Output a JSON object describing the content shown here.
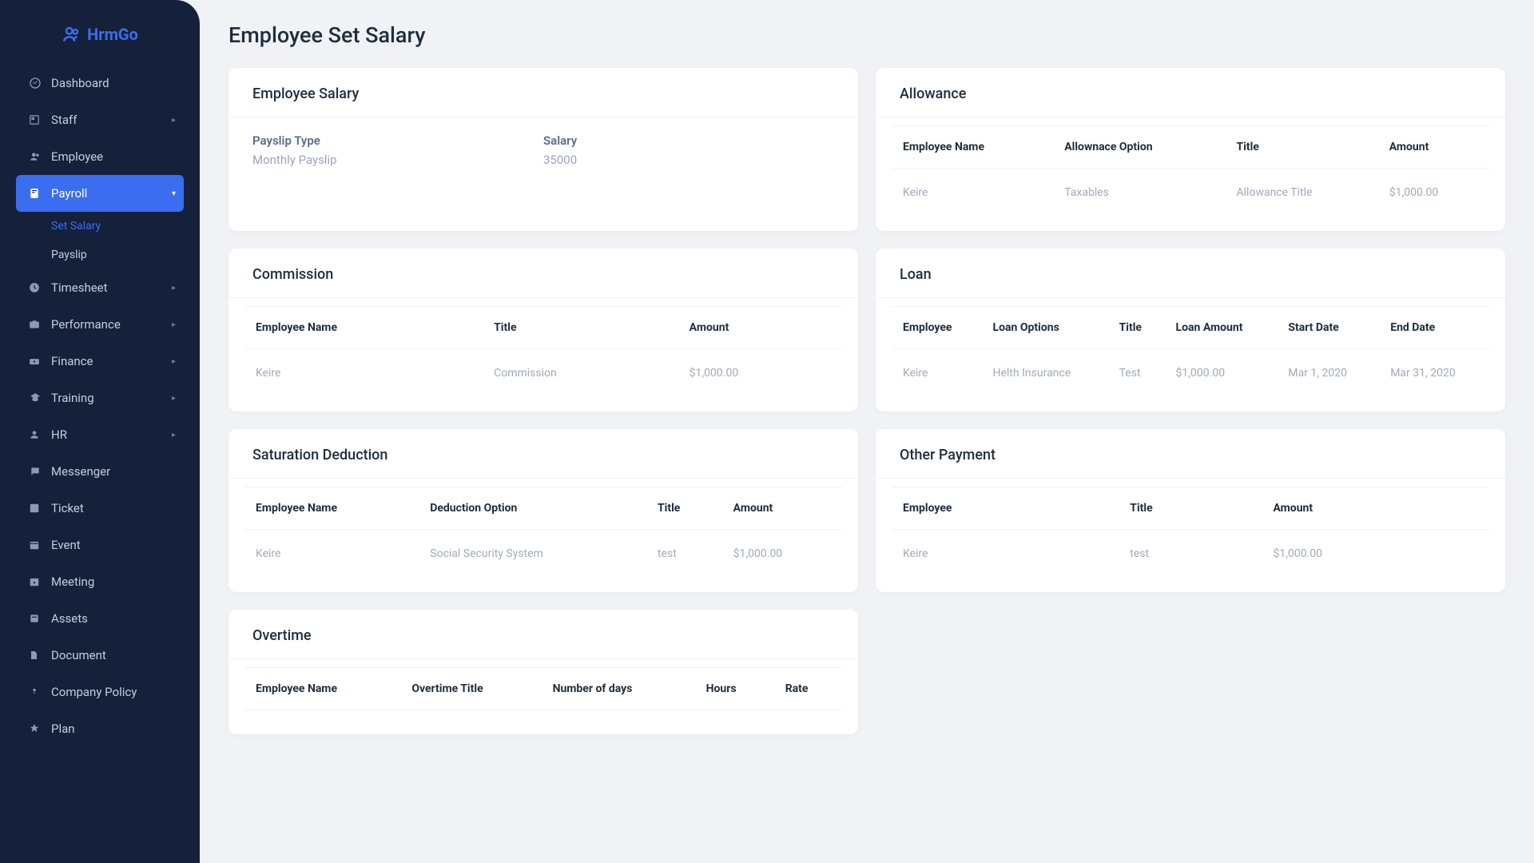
{
  "brand": "HrmGo",
  "sidebar": {
    "items": [
      {
        "icon": "dashboard",
        "label": "Dashboard",
        "expandable": false
      },
      {
        "icon": "staff",
        "label": "Staff",
        "expandable": true
      },
      {
        "icon": "employee",
        "label": "Employee",
        "expandable": false
      },
      {
        "icon": "payroll",
        "label": "Payroll",
        "expandable": true,
        "active": true,
        "children": [
          {
            "label": "Set Salary",
            "active": true
          },
          {
            "label": "Payslip",
            "active": false
          }
        ]
      },
      {
        "icon": "timesheet",
        "label": "Timesheet",
        "expandable": true
      },
      {
        "icon": "performance",
        "label": "Performance",
        "expandable": true
      },
      {
        "icon": "finance",
        "label": "Finance",
        "expandable": true
      },
      {
        "icon": "training",
        "label": "Training",
        "expandable": true
      },
      {
        "icon": "hr",
        "label": "HR",
        "expandable": true
      },
      {
        "icon": "messenger",
        "label": "Messenger",
        "expandable": false
      },
      {
        "icon": "ticket",
        "label": "Ticket",
        "expandable": false
      },
      {
        "icon": "event",
        "label": "Event",
        "expandable": false
      },
      {
        "icon": "meeting",
        "label": "Meeting",
        "expandable": false
      },
      {
        "icon": "assets",
        "label": "Assets",
        "expandable": false
      },
      {
        "icon": "document",
        "label": "Document",
        "expandable": false
      },
      {
        "icon": "policy",
        "label": "Company Policy",
        "expandable": false
      },
      {
        "icon": "plan",
        "label": "Plan",
        "expandable": false
      }
    ]
  },
  "page": {
    "title": "Employee Set Salary"
  },
  "cards": {
    "salary": {
      "title": "Employee Salary",
      "payslip_type_label": "Payslip Type",
      "payslip_type_value": "Monthly Payslip",
      "salary_label": "Salary",
      "salary_value": "35000"
    },
    "allowance": {
      "title": "Allowance",
      "headers": [
        "Employee Name",
        "Allownace Option",
        "Title",
        "Amount"
      ],
      "row": [
        "Keire",
        "Taxables",
        "Allowance Title",
        "$1,000.00"
      ]
    },
    "commission": {
      "title": "Commission",
      "headers": [
        "Employee Name",
        "Title",
        "Amount"
      ],
      "row": [
        "Keire",
        "Commission",
        "$1,000.00"
      ]
    },
    "loan": {
      "title": "Loan",
      "headers": [
        "Employee",
        "Loan Options",
        "Title",
        "Loan Amount",
        "Start Date",
        "End Date"
      ],
      "row": [
        "Keire",
        "Helth Insurance",
        "Test",
        "$1,000.00",
        "Mar 1, 2020",
        "Mar 31, 2020"
      ]
    },
    "deduction": {
      "title": "Saturation Deduction",
      "headers": [
        "Employee Name",
        "Deduction Option",
        "Title",
        "Amount"
      ],
      "row": [
        "Keire",
        "Social Security System",
        "test",
        "$1,000.00"
      ]
    },
    "other": {
      "title": "Other Payment",
      "headers": [
        "Employee",
        "Title",
        "Amount"
      ],
      "row": [
        "Keire",
        "test",
        "$1,000.00"
      ]
    },
    "overtime": {
      "title": "Overtime",
      "headers": [
        "Employee Name",
        "Overtime Title",
        "Number of days",
        "Hours",
        "Rate"
      ]
    }
  }
}
